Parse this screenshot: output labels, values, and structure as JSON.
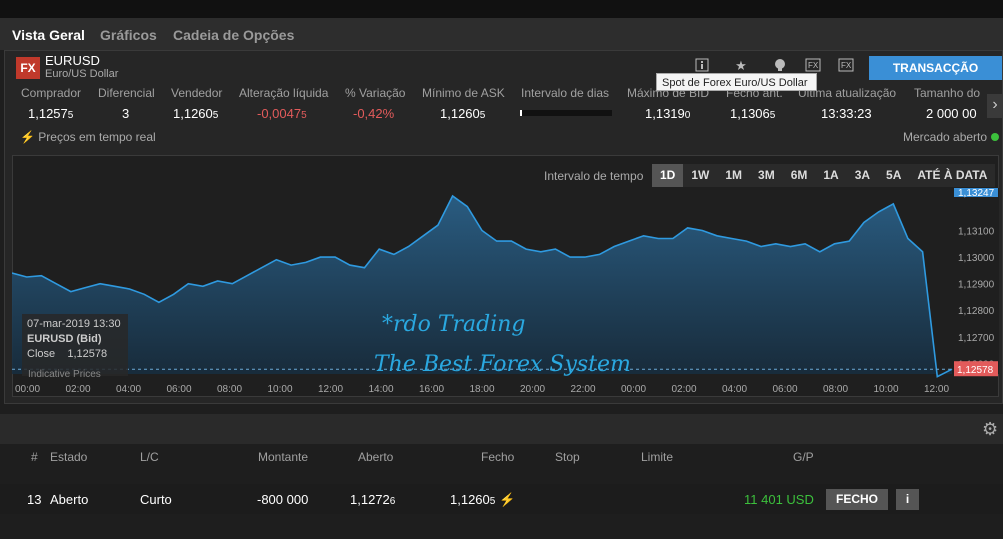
{
  "tabs": [
    "Vista Geral",
    "Gráficos",
    "Cadeia de Opções"
  ],
  "instrument": {
    "badge": "FX",
    "symbol": "EURUSD",
    "description": "Euro/US Dollar",
    "tooltip": "Spot de Forex Euro/US Dollar",
    "trade_button": "TRANSACÇÃO"
  },
  "toolbar_icons": [
    "info-icon",
    "star-icon",
    "alert-icon",
    "fx-icon",
    "fx-alt-icon"
  ],
  "quote": {
    "headers": [
      "Comprador",
      "Diferencial",
      "Vendedor",
      "Alteração líquida",
      "% Variação",
      "Mínimo de ASK",
      "Intervalo de dias",
      "Máximo de BID",
      "Fecho ant.",
      "Última atualização",
      "Tamanho do"
    ],
    "bid": {
      "main": "1,1257",
      "small": "5"
    },
    "spread": "3",
    "ask": {
      "main": "1,1260",
      "small": "5"
    },
    "net_change": {
      "main": "-0,0047",
      "small": "5"
    },
    "pct_change": "-0,42%",
    "min_ask": {
      "main": "1,1260",
      "small": "5"
    },
    "max_bid": {
      "main": "1,1319",
      "small": "0"
    },
    "prev_close": {
      "main": "1,1306",
      "small": "5"
    },
    "last_update": "13:33:23",
    "size": "2 000 00"
  },
  "status": {
    "realtime": "Preços em tempo real",
    "market": "Mercado aberto"
  },
  "interval": {
    "label": "Intervalo de tempo",
    "options": [
      "1D",
      "1W",
      "1M",
      "3M",
      "6M",
      "1A",
      "3A",
      "5A",
      "ATÉ À DATA"
    ],
    "selected": "1D"
  },
  "chart_data": {
    "type": "area",
    "series": [
      {
        "name": "EURUSD (Bid)",
        "values": [
          1.1294,
          1.12925,
          1.1293,
          1.129,
          1.1287,
          1.12885,
          1.129,
          1.1289,
          1.1288,
          1.1286,
          1.1283,
          1.1286,
          1.129,
          1.1289,
          1.1291,
          1.129,
          1.1293,
          1.1296,
          1.1299,
          1.1297,
          1.1298,
          1.13,
          1.13,
          1.1297,
          1.1296,
          1.1303,
          1.1301,
          1.1304,
          1.1308,
          1.1312,
          1.1323,
          1.1319,
          1.131,
          1.1306,
          1.1306,
          1.1303,
          1.1302,
          1.1303,
          1.13,
          1.13,
          1.1301,
          1.1304,
          1.1306,
          1.1308,
          1.1307,
          1.1307,
          1.1311,
          1.131,
          1.1308,
          1.1307,
          1.1306,
          1.1304,
          1.1305,
          1.1304,
          1.1305,
          1.1302,
          1.1305,
          1.1306,
          1.1313,
          1.1317,
          1.132,
          1.1307,
          1.1302,
          1.1255,
          1.12578
        ]
      }
    ],
    "x_ticks": [
      "00:00",
      "02:00",
      "04:00",
      "06:00",
      "08:00",
      "10:00",
      "12:00",
      "14:00",
      "16:00",
      "18:00",
      "20:00",
      "22:00",
      "00:00",
      "02:00",
      "04:00",
      "06:00",
      "08:00",
      "10:00",
      "12:00"
    ],
    "y_ticks": [
      "1,13100",
      "1,13000",
      "1,12900",
      "1,12800",
      "1,12700",
      "1,12600"
    ],
    "ylim": [
      1.1256,
      1.1326
    ],
    "top_label": "1,13247",
    "last_label": "1,12578",
    "grid": false
  },
  "hover_info": {
    "datetime": "07-mar-2019 13:30",
    "series": "EURUSD (Bid)",
    "close_label": "Close",
    "close_value": "1,12578",
    "note": "Indicative Prices"
  },
  "watermark": {
    "line1": "*rdo Trading",
    "line2": "The Best Forex System"
  },
  "positions": {
    "headers": [
      "#",
      "Estado",
      "L/C",
      "Montante",
      "Aberto",
      "Fecho",
      "Stop",
      "Limite",
      "G/P"
    ],
    "row": {
      "id": "13",
      "state": "Aberto",
      "side": "Curto",
      "amount": "-800 000",
      "open": {
        "main": "1,1272",
        "small": "6"
      },
      "close": {
        "main": "1,1260",
        "small": "5"
      },
      "pnl": "11 401 USD",
      "close_button": "FECHO",
      "info_button": "i"
    }
  },
  "colors": {
    "accent": "#3a8fd6",
    "negative": "#e25b5b",
    "positive": "#3cc03c",
    "line": "#2f9ae0",
    "badge": "#c0392b"
  }
}
